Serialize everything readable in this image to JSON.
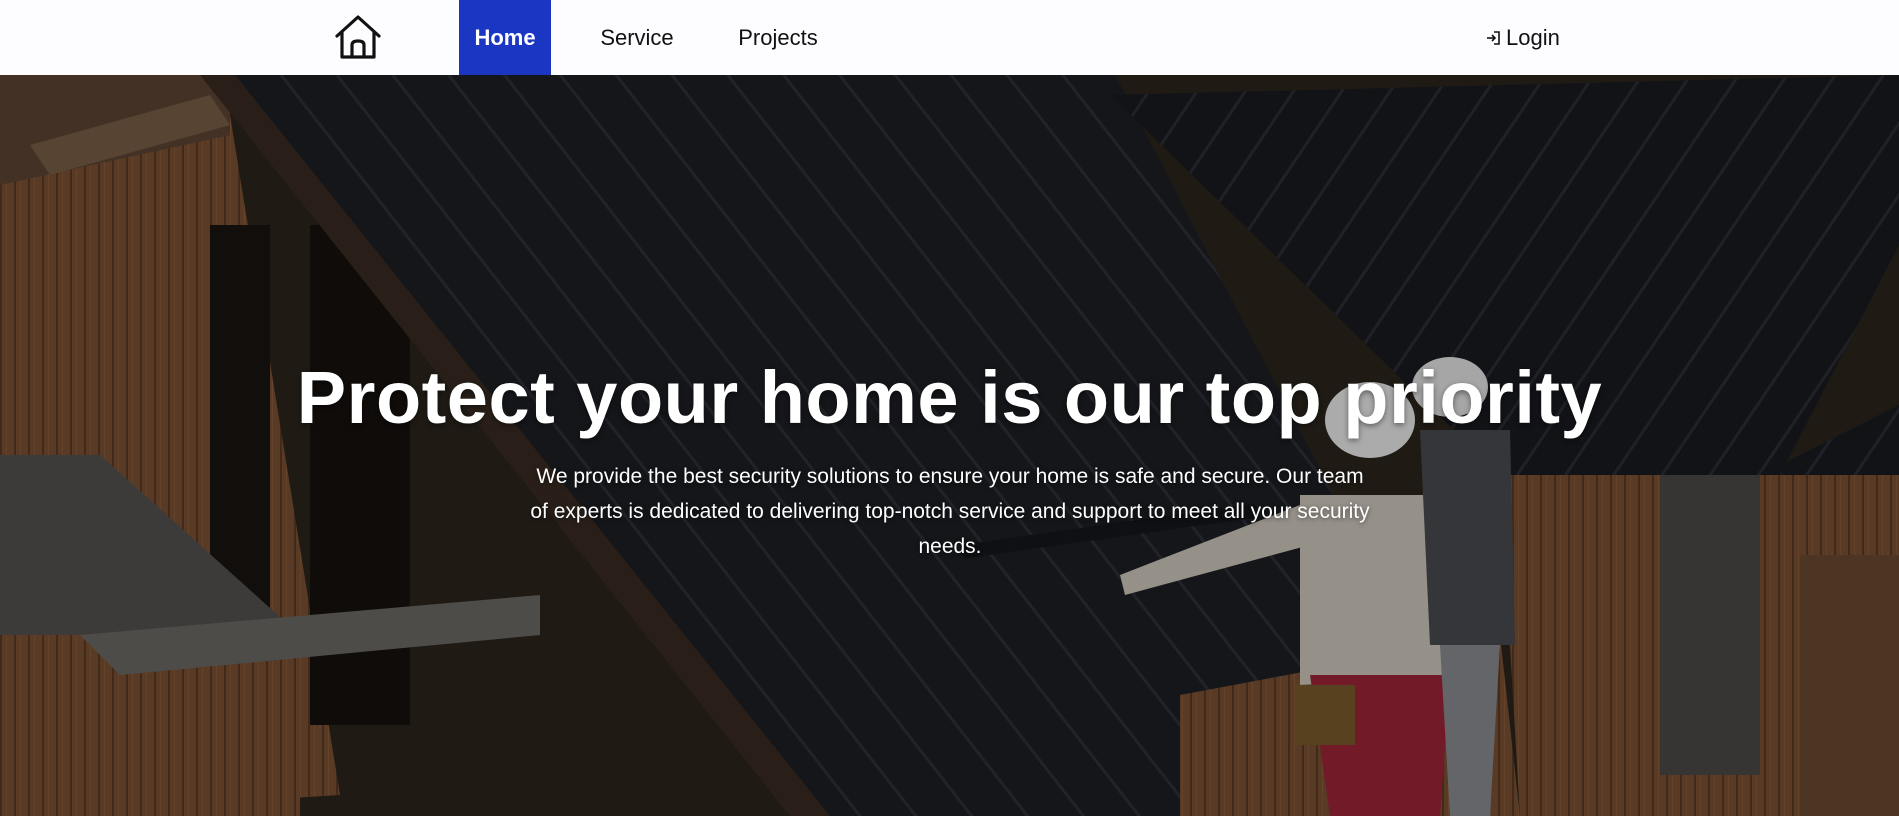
{
  "nav": {
    "logo_icon": "house-icon",
    "items": [
      {
        "label": "Home",
        "active": true
      },
      {
        "label": "Service",
        "active": false
      },
      {
        "label": "Projects",
        "active": false
      }
    ],
    "login_icon": "login-arrow-icon",
    "login_label": "Login",
    "active_color": "#1a36c2"
  },
  "hero": {
    "title": "Protect your home is our top priority",
    "subtitle": "We provide the best security solutions to ensure your home is safe and secure. Our team of experts is dedicated to delivering top-notch service and support to meet all your security needs."
  }
}
